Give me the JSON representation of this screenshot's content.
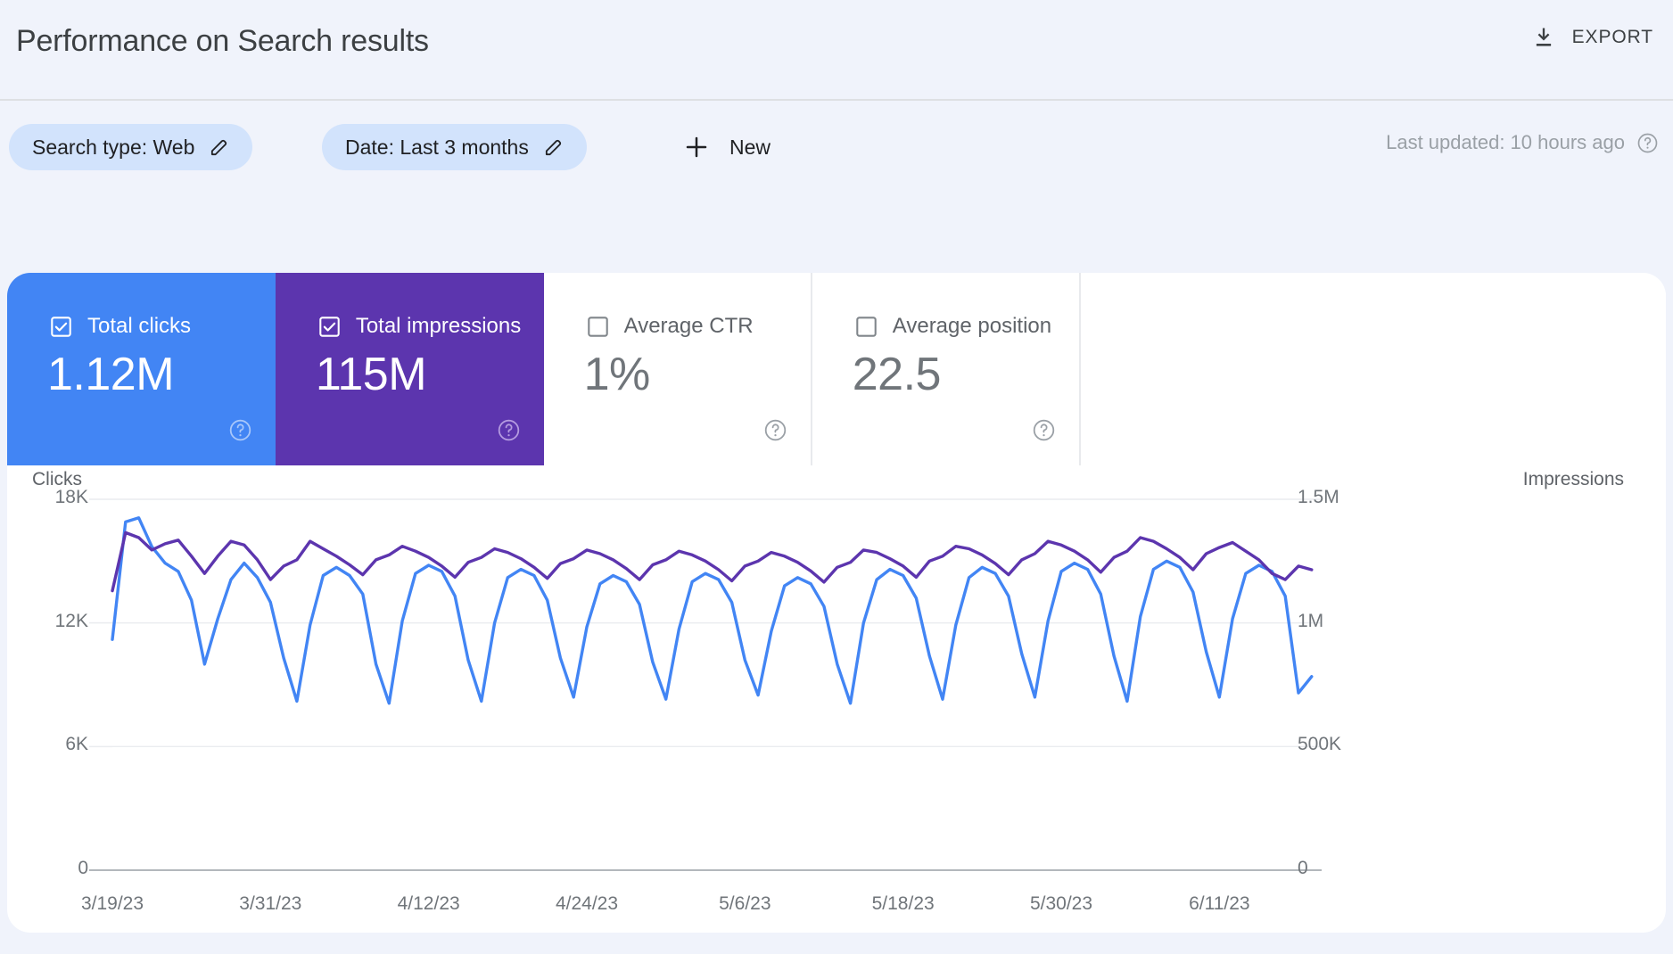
{
  "header": {
    "title": "Performance on Search results",
    "export_label": "EXPORT",
    "export_icon": "download-icon"
  },
  "filters": {
    "chips": [
      {
        "label": "Search type: Web",
        "icon": "pencil-icon"
      },
      {
        "label": "Date: Last 3 months",
        "icon": "pencil-icon"
      }
    ],
    "new_label": "New",
    "new_icon": "plus-icon",
    "last_updated": "Last updated: 10 hours ago",
    "last_updated_icon": "help-circle-icon"
  },
  "metrics": [
    {
      "name": "Total clicks",
      "value": "1.12M",
      "checked": true,
      "color": "#4285F4",
      "help_icon": "help-circle-icon"
    },
    {
      "name": "Total impressions",
      "value": "115M",
      "checked": true,
      "color": "#5C35AE",
      "help_icon": "help-circle-icon"
    },
    {
      "name": "Average CTR",
      "value": "1%",
      "checked": false,
      "color": "#FFFFFF",
      "help_icon": "help-circle-icon"
    },
    {
      "name": "Average position",
      "value": "22.5",
      "checked": false,
      "color": "#FFFFFF",
      "help_icon": "help-circle-icon"
    }
  ],
  "chart_data": {
    "type": "line",
    "title": "",
    "xlabel": "",
    "ylabel": "Clicks",
    "y2label": "Impressions",
    "grid": true,
    "legend_position": "none",
    "ylim": [
      0,
      18000
    ],
    "y2lim": [
      0,
      1500000
    ],
    "yticks": [
      "0",
      "6K",
      "12K",
      "18K"
    ],
    "ytick_values": [
      0,
      6000,
      12000,
      18000
    ],
    "y2ticks": [
      "0",
      "500K",
      "1M",
      "1.5M"
    ],
    "y2tick_values": [
      0,
      500000,
      1000000,
      1500000
    ],
    "xticks": [
      "3/19/23",
      "3/31/23",
      "4/12/23",
      "4/24/23",
      "5/6/23",
      "5/18/23",
      "5/30/23",
      "6/11/23"
    ],
    "xtick_indices": [
      0,
      12,
      24,
      36,
      48,
      60,
      72,
      84
    ],
    "x_start": "3/19/23",
    "x_end": "6/17/23",
    "n_points": 91,
    "series": [
      {
        "name": "Total clicks",
        "color": "#4285F4",
        "axis": "left",
        "values": [
          11200,
          16900,
          17100,
          15700,
          14900,
          14500,
          13100,
          10000,
          12200,
          14100,
          14900,
          14200,
          13000,
          10300,
          8200,
          11900,
          14300,
          14700,
          14300,
          13400,
          10000,
          8100,
          12100,
          14400,
          14800,
          14500,
          13300,
          10200,
          8200,
          12000,
          14200,
          14600,
          14300,
          13100,
          10300,
          8400,
          11800,
          13900,
          14300,
          14000,
          12900,
          10100,
          8300,
          11700,
          14000,
          14400,
          14100,
          13000,
          10200,
          8500,
          11600,
          13800,
          14200,
          13900,
          12800,
          10000,
          8100,
          12000,
          14100,
          14600,
          14300,
          13200,
          10400,
          8300,
          11900,
          14200,
          14700,
          14400,
          13300,
          10500,
          8400,
          12100,
          14500,
          14900,
          14600,
          13400,
          10400,
          8200,
          12300,
          14600,
          15000,
          14700,
          13500,
          10600,
          8400,
          12200,
          14400,
          14800,
          14500,
          13300,
          8600,
          9400
        ]
      },
      {
        "name": "Total impressions",
        "color": "#5C35AE",
        "axis": "right",
        "values": [
          1130000,
          1365000,
          1345000,
          1295000,
          1320000,
          1335000,
          1270000,
          1200000,
          1270000,
          1330000,
          1315000,
          1255000,
          1175000,
          1230000,
          1255000,
          1330000,
          1300000,
          1270000,
          1235000,
          1195000,
          1255000,
          1275000,
          1310000,
          1290000,
          1265000,
          1230000,
          1185000,
          1245000,
          1265000,
          1300000,
          1285000,
          1260000,
          1225000,
          1180000,
          1240000,
          1260000,
          1295000,
          1280000,
          1255000,
          1220000,
          1175000,
          1235000,
          1255000,
          1290000,
          1275000,
          1250000,
          1215000,
          1170000,
          1230000,
          1250000,
          1285000,
          1270000,
          1245000,
          1210000,
          1165000,
          1225000,
          1245000,
          1295000,
          1285000,
          1260000,
          1230000,
          1185000,
          1250000,
          1270000,
          1310000,
          1300000,
          1275000,
          1240000,
          1195000,
          1255000,
          1280000,
          1330000,
          1315000,
          1290000,
          1255000,
          1205000,
          1265000,
          1290000,
          1345000,
          1330000,
          1300000,
          1265000,
          1215000,
          1280000,
          1305000,
          1325000,
          1290000,
          1255000,
          1200000,
          1175000,
          1230000,
          1215000
        ]
      }
    ]
  }
}
